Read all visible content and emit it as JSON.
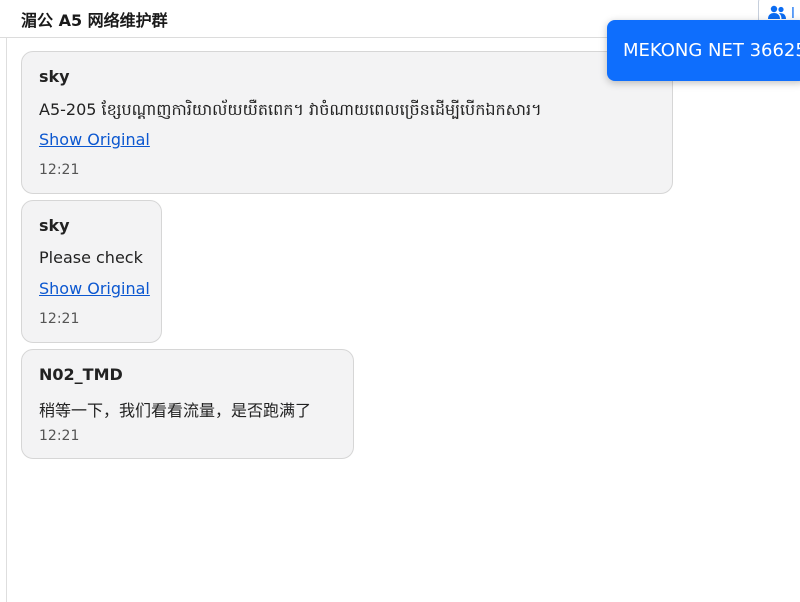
{
  "header": {
    "title": "湄公 A5 网络维护群",
    "members_button": {
      "icon": "members-icon",
      "label_fragment": "l"
    }
  },
  "messages": [
    {
      "sender": "sky",
      "text": "A5-205 ខ្សែបណ្តាញការិយាល័យយឺតពេក។ វាចំណាយពេលច្រើនដើម្បីបើកឯកសារ។",
      "show_original_label": "Show Original",
      "time": "12:21"
    },
    {
      "sender": "sky",
      "text": "Please check",
      "show_original_label": "Show Original",
      "time": "12:21"
    },
    {
      "sender": "N02_TMD",
      "text": "稍等一下，我们看看流量，是否跑满了",
      "time": "12:21"
    }
  ],
  "toast": {
    "text": "MEKONG NET 36625"
  },
  "colors": {
    "accent": "#0e6efd",
    "link": "#0b57d0",
    "bubble_background": "#f3f3f4",
    "bubble_border": "#d6d6d6"
  }
}
